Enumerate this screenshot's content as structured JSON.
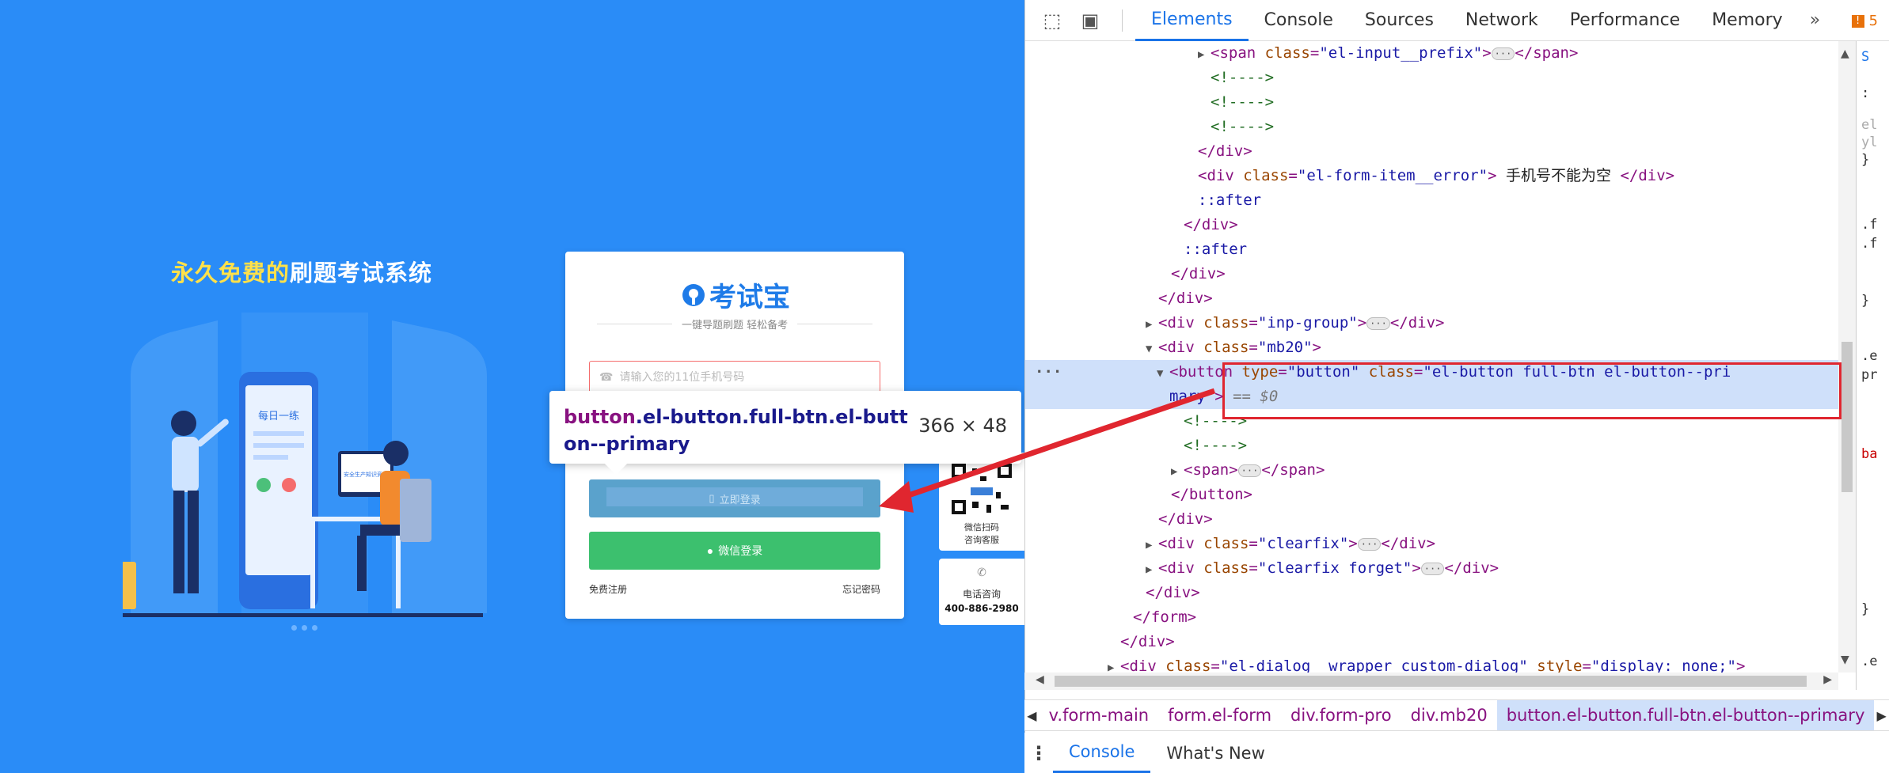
{
  "page": {
    "slogan_highlight": "永久免费的",
    "slogan_rest": "刷题考试系统",
    "illustration_label": "每日一练",
    "illustration_screen_label": "安全生产知识竞赛",
    "logo": "考试宝",
    "subtitle": "一键导题刷题 轻松备考",
    "phone_placeholder": "请输入您的11位手机号码",
    "login_button": "立即登录",
    "wechat_button": "微信登录",
    "register_link": "免费注册",
    "forgot_link": "忘记密码",
    "qr_text_1": "微信扫码",
    "qr_text_2": "咨询客服",
    "tel_label": "电话咨询",
    "tel_number": "400-886-2980",
    "tooltip_tag": "button",
    "tooltip_selector": ".el-button.full-btn.el-button--primary",
    "tooltip_size": "366 × 48",
    "colors": {
      "page_bg": "#2a8cf7",
      "wechat_green": "#3cc06e",
      "highlight_yellow": "#ffe14a",
      "annotation_red": "#e0262f"
    }
  },
  "devtools": {
    "tabs": [
      "Elements",
      "Console",
      "Sources",
      "Network",
      "Performance",
      "Memory"
    ],
    "active_tab": "Elements",
    "more_tabs": "»",
    "issues_count": "5",
    "tree": {
      "r1": {
        "tag_open": "<span",
        "attr": "class",
        "val": "\"el-input__prefix\"",
        "end": ">",
        "close": "</span>"
      },
      "comment": "<!---->",
      "div_close": "</div>",
      "r5": {
        "tag_open": "<div",
        "attr": "class",
        "val": "\"el-form-item__error\"",
        "end": ">",
        "text": " 手机号不能为空 ",
        "close": "</div>"
      },
      "after": "::after",
      "r14": {
        "tag_open": "<div",
        "attr": "class",
        "val": "\"inp-group\"",
        "end": ">",
        "close": "</div>"
      },
      "r15": {
        "tag_open": "<div",
        "attr": "class",
        "val": "\"mb20\"",
        "end": ">"
      },
      "sel": {
        "tag_open": "<button",
        "attr1": "type",
        "val1": "\"button\"",
        "attr2": "class",
        "val2a": "\"el-button full-btn el-button--pri",
        "val2b": "mary\"",
        "end": ">",
        "eq": " == $0"
      },
      "span_row": {
        "open": "<span>",
        "close": "</span>"
      },
      "button_close": "</button>",
      "r21": {
        "tag_open": "<div",
        "attr": "class",
        "val": "\"clearfix\"",
        "end": ">",
        "close": "</div>"
      },
      "r22": {
        "tag_open": "<div",
        "attr": "class",
        "val": "\"clearfix forget\"",
        "end": ">",
        "close": "</div>"
      },
      "form_close": "</form>",
      "r26": {
        "tag_open": "<div",
        "attr1": "class",
        "val1": "\"el-dialog__wrapper custom-dialog\"",
        "attr2": "style",
        "val2": "\"display: none;\"",
        "end": ">"
      }
    },
    "styles_snippets": [
      "S",
      ":",
      "el",
      "yl",
      "}",
      ".f",
      ".f",
      "}",
      ".e",
      "pr",
      "ba",
      "}",
      ".e"
    ],
    "breadcrumbs": [
      "v.form-main",
      "form.el-form",
      "div.form-pro",
      "div.mb20",
      "button.el-button.full-btn.el-button--primary"
    ],
    "drawer_tabs": [
      "Console",
      "What's New"
    ]
  }
}
